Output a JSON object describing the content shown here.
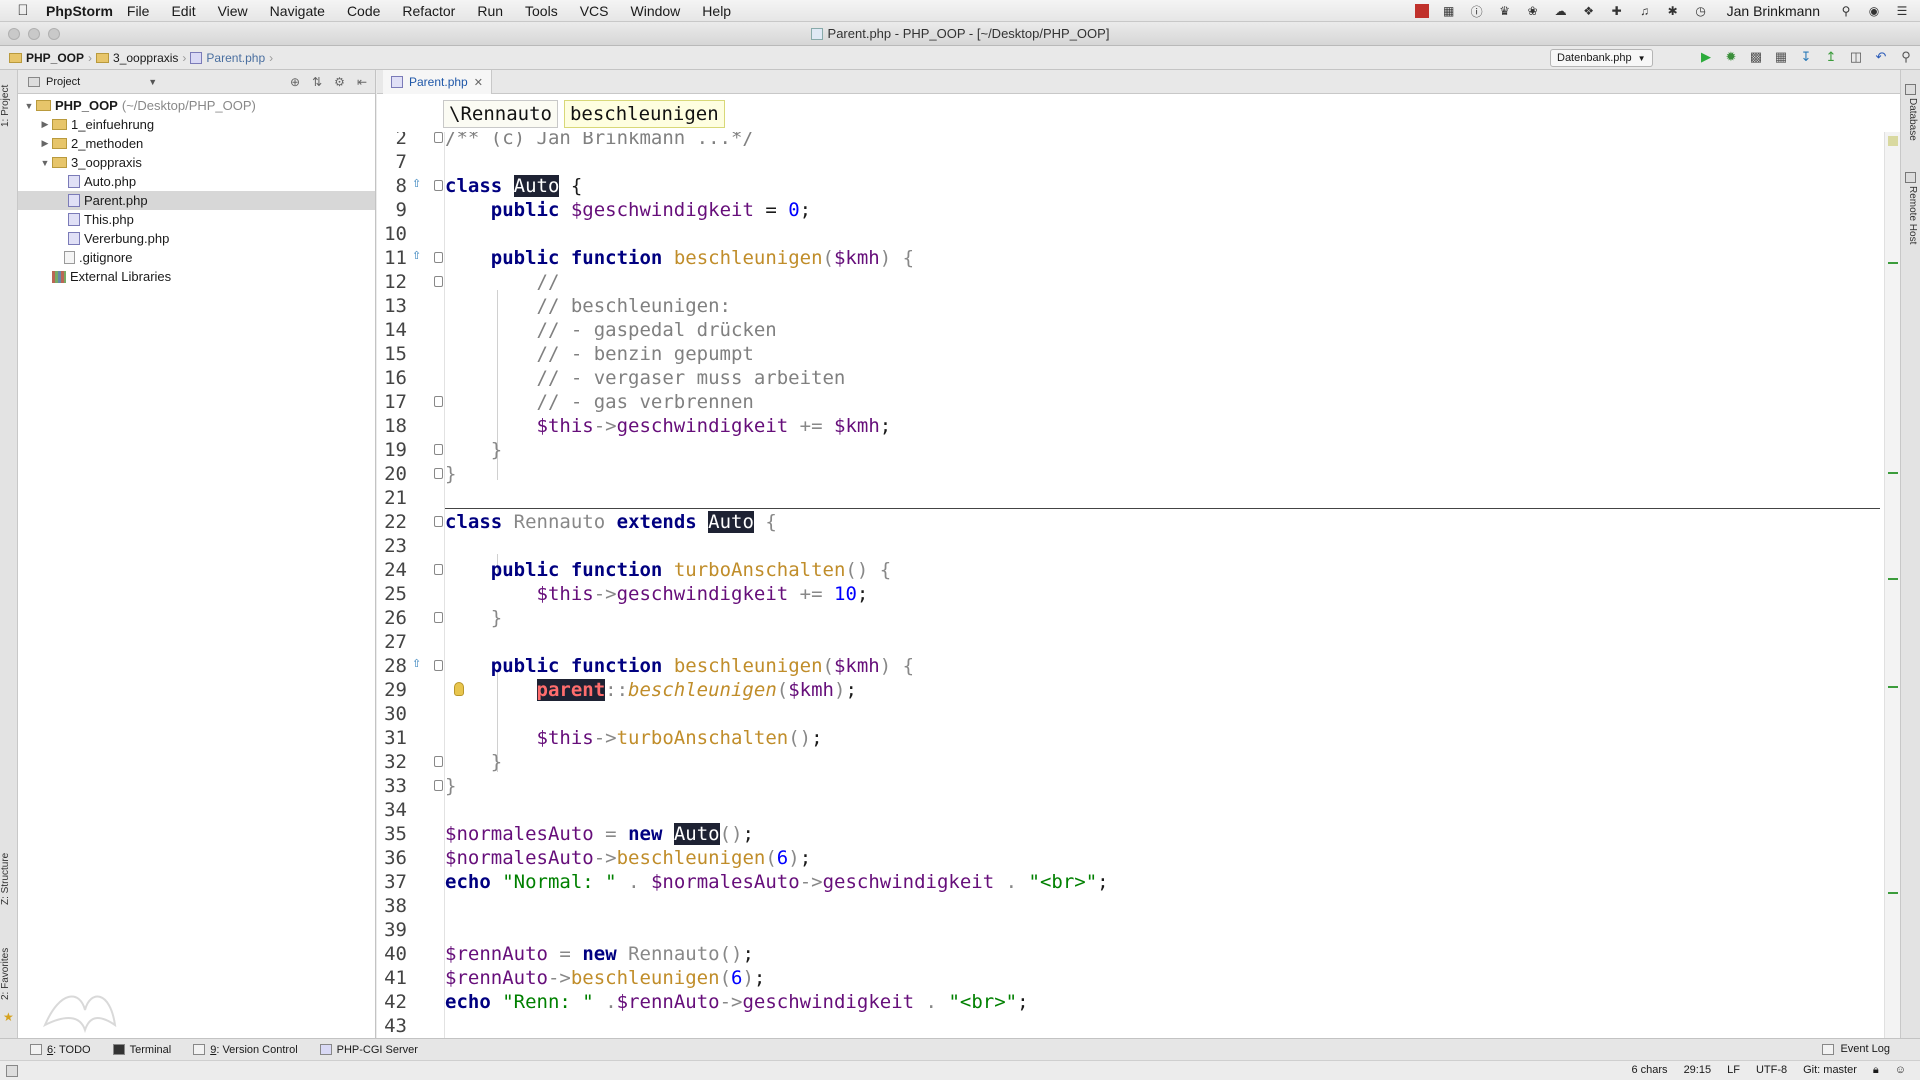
{
  "menubar": {
    "app_name": "PhpStorm",
    "items": [
      "File",
      "Edit",
      "View",
      "Navigate",
      "Code",
      "Refactor",
      "Run",
      "Tools",
      "VCS",
      "Window",
      "Help"
    ],
    "user": "Jan Brinkmann"
  },
  "window": {
    "title": "Parent.php - PHP_OOP - [~/Desktop/PHP_OOP]"
  },
  "navbar": {
    "crumbs": [
      "PHP_OOP",
      "3_ooppraxis",
      "Parent.php"
    ],
    "run_config": "Datenbank.php"
  },
  "project": {
    "header": "Project",
    "tree": [
      {
        "label": "PHP_OOP",
        "path": "(~/Desktop/PHP_OOP)"
      },
      {
        "label": "1_einfuehrung"
      },
      {
        "label": "2_methoden"
      },
      {
        "label": "3_ooppraxis"
      },
      {
        "label": "Auto.php"
      },
      {
        "label": "Parent.php"
      },
      {
        "label": "This.php"
      },
      {
        "label": "Vererbung.php"
      },
      {
        "label": ".gitignore"
      },
      {
        "label": "External Libraries"
      }
    ]
  },
  "side_tabs": {
    "project": "1: Project",
    "structure": "Z: Structure",
    "favorites": "2: Favorites",
    "database": "Database",
    "remote_host": "Remote Host"
  },
  "editor": {
    "tab": "Parent.php",
    "breadcrumbs": [
      "\\Rennauto",
      "beschleunigen"
    ],
    "line_numbers": [
      "2",
      "7",
      "8",
      "9",
      "10",
      "11",
      "12",
      "13",
      "14",
      "15",
      "16",
      "17",
      "18",
      "19",
      "20",
      "21",
      "22",
      "23",
      "24",
      "25",
      "26",
      "27",
      "28",
      "29",
      "30",
      "31",
      "32",
      "33",
      "34",
      "35",
      "36",
      "37",
      "38",
      "39",
      "40",
      "41",
      "42",
      "43"
    ],
    "lines": {
      "l2": "/** (c) Jan Brinkmann ...*/",
      "l8_kw": "class",
      "l8_cls": "Auto",
      "l8_end": " {",
      "l9_kw": "public",
      "l9_var": "$geschwindigkeit",
      "l9_op": " = ",
      "l9_num": "0",
      "l9_end": ";",
      "l11_kw": "public function",
      "l11_fn": "beschleunigen",
      "l11_var": "$kmh",
      "l12": "//",
      "l13": "// beschleunigen:",
      "l14": "// - gaspedal drücken",
      "l15": "// - benzin gepumpt",
      "l16": "// - vergaser muss arbeiten",
      "l17": "// - gas verbrennen",
      "l18_var": "$this",
      "l18_prop": "geschwindigkeit",
      "l18_var2": "$kmh",
      "l22_kw": "class",
      "l22_cls": "Rennauto",
      "l22_kw2": "extends",
      "l22_cls2": "Auto",
      "l24_kw": "public function",
      "l24_fn": "turboAnschalten",
      "l25_var": "$this",
      "l25_prop": "geschwindigkeit",
      "l25_num": "10",
      "l28_kw": "public function",
      "l28_fn": "beschleunigen",
      "l28_var": "$kmh",
      "l29_parent": "parent",
      "l29_fn": "beschleunigen",
      "l29_var": "$kmh",
      "l31_var": "$this",
      "l31_fn": "turboAnschalten",
      "l35_var": "$normalesAuto",
      "l35_kw": "new",
      "l35_cls": "Auto",
      "l36_var": "$normalesAuto",
      "l36_fn": "beschleunigen",
      "l36_num": "6",
      "l37_kw": "echo",
      "l37_str": "\"Normal: \"",
      "l37_var": "$normalesAuto",
      "l37_prop": "geschwindigkeit",
      "l37_str2": "\"<br>\"",
      "l40_var": "$rennAuto",
      "l40_kw": "new",
      "l40_cls": "Rennauto",
      "l41_var": "$rennAuto",
      "l41_fn": "beschleunigen",
      "l41_num": "6",
      "l42_kw": "echo",
      "l42_str": "\"Renn: \"",
      "l42_var": "$rennAuto",
      "l42_prop": "geschwindigkeit",
      "l42_str2": "\"<br>\""
    }
  },
  "bottom_tabs": [
    {
      "mnemonic": "6",
      "label": ": TODO"
    },
    {
      "mnemonic": "",
      "label": "Terminal"
    },
    {
      "mnemonic": "9",
      "label": ": Version Control"
    },
    {
      "mnemonic": "",
      "label": "PHP-CGI Server"
    }
  ],
  "event_log": "Event Log",
  "status": {
    "chars": "6 chars",
    "position": "29:15",
    "line_sep": "LF",
    "encoding": "UTF-8",
    "git": "Git: master"
  },
  "colors": {
    "keyword": "#000080",
    "variable": "#660e7a",
    "comment": "#808080",
    "string": "#008000",
    "number": "#0000ff",
    "function": "#c08d2a"
  }
}
